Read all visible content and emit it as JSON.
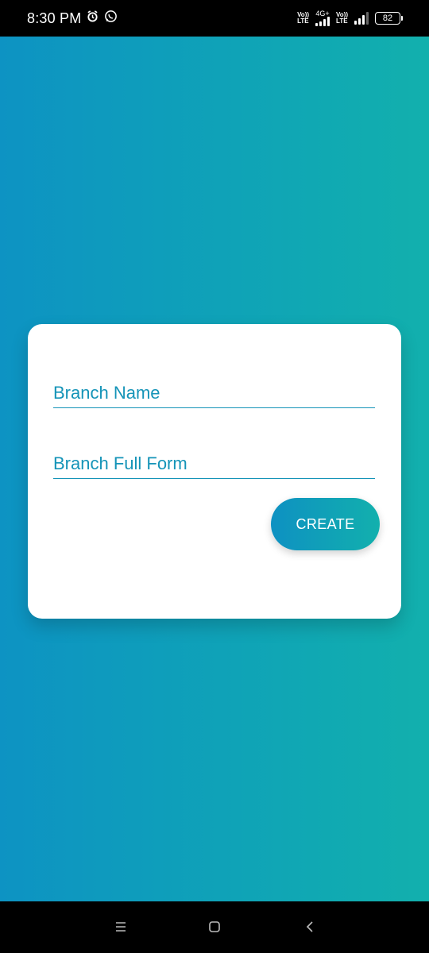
{
  "status_bar": {
    "time": "8:30 PM",
    "alarm_icon": "alarm-icon",
    "whatsapp_icon": "whatsapp-icon",
    "sim1_top": "Vo))",
    "sim1_bottom": "LTE",
    "network_type": "4G+",
    "sim2_top": "Vo))",
    "sim2_bottom": "LTE",
    "battery": "82"
  },
  "form": {
    "branch_name_placeholder": "Branch Name",
    "branch_name_value": "",
    "branch_full_form_placeholder": "Branch Full Form",
    "branch_full_form_value": "",
    "create_label": "CREATE"
  },
  "nav_bar": {
    "menu_icon": "menu-icon",
    "home_icon": "home-icon",
    "back_icon": "back-icon"
  },
  "colors": {
    "gradient_start": "#0d93c3",
    "gradient_end": "#12b0ad",
    "accent_text": "#1594b8",
    "card": "#ffffff"
  }
}
